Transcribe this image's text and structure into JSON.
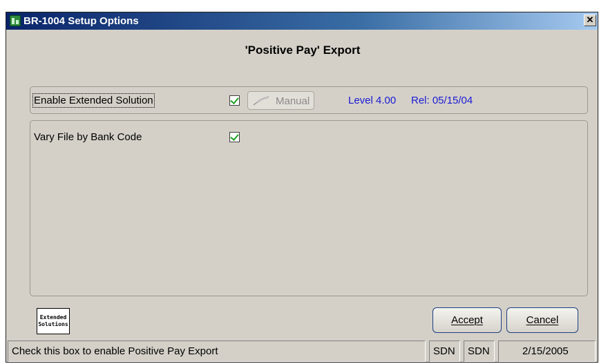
{
  "window": {
    "title": "BR-1004 Setup Options",
    "close_symbol": "✕"
  },
  "heading": "'Positive Pay' Export",
  "enable_extended": {
    "label": "Enable Extended Solution",
    "checked": true,
    "manual_label": "Manual",
    "level": "Level 4.00",
    "release": "Rel: 05/15/04"
  },
  "options": {
    "vary_file_label": "Vary File by Bank Code",
    "vary_file_checked": true
  },
  "logo": {
    "line1": "Extended",
    "line2": "Solutions"
  },
  "buttons": {
    "accept": "Accept",
    "cancel": "Cancel"
  },
  "status": {
    "message": "Check this box to enable Positive Pay Export",
    "company": "SDN",
    "user": "SDN",
    "date": "2/15/2005"
  },
  "colors": {
    "title_bar": "#0a246a",
    "info_text": "#1a1ad4",
    "check": "#21a121",
    "button_border": "#1c3f80"
  },
  "icons": {
    "app": "green-building-icon",
    "manual": "feather-icon",
    "close": "close-icon"
  }
}
